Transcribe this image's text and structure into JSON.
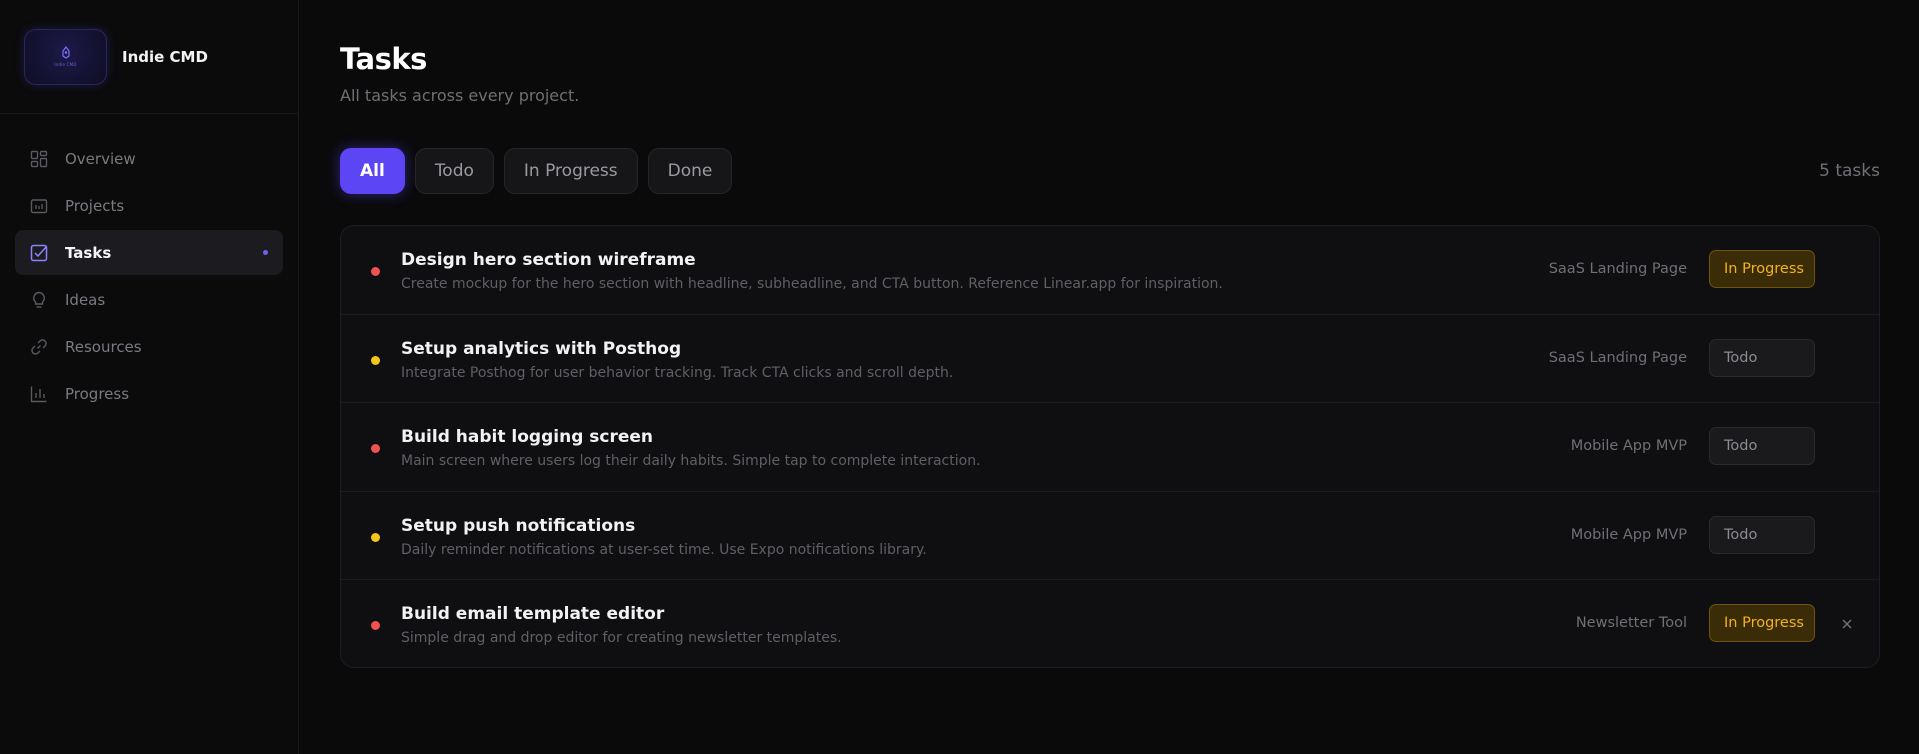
{
  "brand": {
    "name": "Indie CMD",
    "logo_text": "Indie CMD"
  },
  "sidebar": {
    "items": [
      {
        "label": "Overview",
        "icon": "grid-icon",
        "active": false
      },
      {
        "label": "Projects",
        "icon": "folder-icon",
        "active": false
      },
      {
        "label": "Tasks",
        "icon": "checkbox-icon",
        "active": true
      },
      {
        "label": "Ideas",
        "icon": "lightbulb-icon",
        "active": false
      },
      {
        "label": "Resources",
        "icon": "link-icon",
        "active": false
      },
      {
        "label": "Progress",
        "icon": "bar-chart-icon",
        "active": false
      }
    ]
  },
  "page": {
    "title": "Tasks",
    "subtitle": "All tasks across every project."
  },
  "filters": {
    "items": [
      "All",
      "Todo",
      "In Progress",
      "Done"
    ],
    "selected": "All",
    "count_label": "5 tasks"
  },
  "tasks": [
    {
      "title": "Design hero section wireframe",
      "description": "Create mockup for the hero section with headline, subheadline, and CTA button. Reference Linear.app for inspiration.",
      "project": "SaaS Landing Page",
      "status": "In Progress",
      "priority_color": "#f05252"
    },
    {
      "title": "Setup analytics with Posthog",
      "description": "Integrate Posthog for user behavior tracking. Track CTA clicks and scroll depth.",
      "project": "SaaS Landing Page",
      "status": "Todo",
      "priority_color": "#f5c518"
    },
    {
      "title": "Build habit logging screen",
      "description": "Main screen where users log their daily habits. Simple tap to complete interaction.",
      "project": "Mobile App MVP",
      "status": "Todo",
      "priority_color": "#f05252"
    },
    {
      "title": "Setup push notifications",
      "description": "Daily reminder notifications at user-set time. Use Expo notifications library.",
      "project": "Mobile App MVP",
      "status": "Todo",
      "priority_color": "#f5c518"
    },
    {
      "title": "Build email template editor",
      "description": "Simple drag and drop editor for creating newsletter templates.",
      "project": "Newsletter Tool",
      "status": "In Progress",
      "priority_color": "#f05252"
    }
  ],
  "colors": {
    "accent": "#5b45f5",
    "in_progress_text": "#f5b31b",
    "priority_high": "#f05252",
    "priority_medium": "#f5c518"
  }
}
